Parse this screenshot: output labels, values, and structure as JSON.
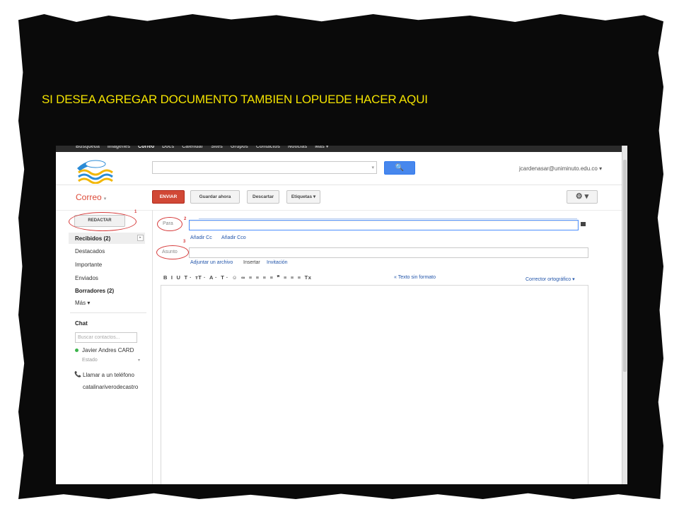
{
  "caption": "SI DESEA AGREGAR DOCUMENTO TAMBIEN LOPUEDE HACER  AQUI",
  "topnav": [
    "Búsqueda",
    "Imágenes",
    "Correo",
    "Docs",
    "Calendar",
    "Sites",
    "Grupos",
    "Contactos",
    "Noticias",
    "Más ▾"
  ],
  "search": {
    "button_icon": "🔍"
  },
  "account": "jcardenasar@uniminuto.edu.co ▾",
  "app": {
    "title": "Correo",
    "caret": "▾"
  },
  "toolbar": {
    "send": "ENVIAR",
    "save": "Guardar ahora",
    "discard": "Descartar",
    "labels": "Etiquetas ▾",
    "gear": "⚙ ▾"
  },
  "sidebar": {
    "compose": "REDACTAR",
    "items": [
      {
        "label": "Recibidos (2)",
        "bold": true
      },
      {
        "label": "Destacados"
      },
      {
        "label": "Importante"
      },
      {
        "label": "Enviados"
      },
      {
        "label": "Borradores (2)",
        "bold": true
      },
      {
        "label": "Más ▾"
      }
    ],
    "chat_title": "Chat",
    "chat_search_placeholder": "Buscar contactos...",
    "contact": "Javier Andres CARD",
    "status": "Estado",
    "call": "Llamar a un teléfono",
    "other_contact": "catalinariverodecastro"
  },
  "annotations": {
    "one": "1",
    "two": "2",
    "three": "3"
  },
  "compose": {
    "to_label": "Para",
    "subject_label": "Asunto",
    "add_cc": "Añadir Cc",
    "add_bcc": "Añadir Cco",
    "attach": "Adjuntar un archivo",
    "insert": "Insertar",
    "invitation": "Invitación",
    "format_buttons": [
      "B",
      "I",
      "U",
      "T ·",
      "ᴛT ·",
      "A ·",
      "T ·",
      "☺",
      "∞",
      "≡",
      "≡",
      "≡",
      "≡",
      "❞",
      "≡",
      "≡",
      "≡",
      "Tx"
    ],
    "plain_text": "« Texto sin formato",
    "spellcheck": "Corrector ortográfico ▾"
  },
  "colors": {
    "frame": "#0a0a0a",
    "caption": "#f2e200",
    "send_button": "#d14836",
    "search_button": "#4787ed",
    "annotation": "#d63a3a",
    "link": "#2255aa"
  }
}
